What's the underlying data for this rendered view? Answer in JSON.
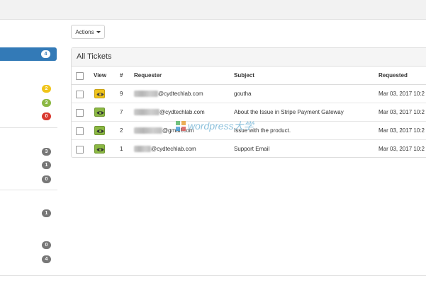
{
  "toolbar": {
    "actions_label": "Actions"
  },
  "sidebar": {
    "badges": [
      {
        "value": "4",
        "color": "white"
      },
      {
        "value": "2",
        "color": "yellow"
      },
      {
        "value": "3",
        "color": "green"
      },
      {
        "value": "0",
        "color": "red"
      },
      {
        "value": "3",
        "color": "gray"
      },
      {
        "value": "1",
        "color": "gray"
      },
      {
        "value": "0",
        "color": "gray"
      },
      {
        "value": "1",
        "color": "gray"
      },
      {
        "value": "0",
        "color": "gray"
      },
      {
        "value": "4",
        "color": "gray"
      }
    ]
  },
  "tickets": {
    "title": "All Tickets",
    "columns": {
      "view": "View",
      "number": "#",
      "requester": "Requester",
      "subject": "Subject",
      "requested": "Requested"
    },
    "rows": [
      {
        "view_status": "yellow",
        "number": "9",
        "requester": "@cydtechlab.com",
        "subject": "goutha",
        "requested": "Mar 03, 2017 10:2"
      },
      {
        "view_status": "green",
        "number": "7",
        "requester": "@cydtechlab.com",
        "subject": "About the Issue in Stripe Payment Gateway",
        "requested": "Mar 03, 2017 10:2"
      },
      {
        "view_status": "green",
        "number": "2",
        "requester": "@gmail.com",
        "subject": "Issue with the product.",
        "requested": "Mar 03, 2017 10:2"
      },
      {
        "view_status": "green",
        "number": "1",
        "requester": "@cydtechlab.com",
        "subject": "Support Email",
        "requested": "Mar 03, 2017 10:2"
      }
    ]
  },
  "watermark": {
    "text": "wordpress大学"
  },
  "colors": {
    "primary": "#337ab7",
    "yellow": "#efc31b",
    "green": "#8bb843",
    "red": "#d9392f",
    "gray": "#777777"
  }
}
